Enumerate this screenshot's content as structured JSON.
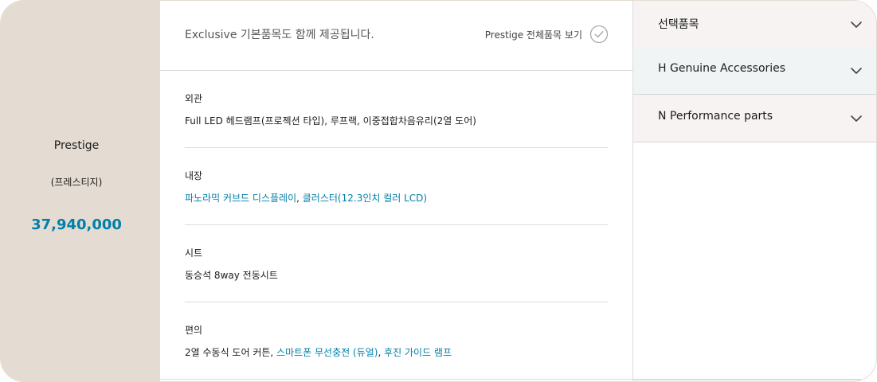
{
  "trim": {
    "name": "Prestige",
    "subtitle": "(프레스티지)",
    "price": "37,940,000"
  },
  "header": {
    "description": "Exclusive 기본품목도 함께 제공됩니다.",
    "view_all_label": "Prestige 전체품목 보기",
    "view_all_icon": "check-circle-icon"
  },
  "sections": [
    {
      "title": "외관",
      "items": [
        {
          "text": "Full LED 헤드램프(프로젝션 타입)",
          "link": false
        },
        {
          "text": ", ",
          "link": false
        },
        {
          "text": "루프랙",
          "link": false
        },
        {
          "text": ", ",
          "link": false
        },
        {
          "text": "이중접합차음유리(2열 도어)",
          "link": false
        }
      ]
    },
    {
      "title": "내장",
      "items": [
        {
          "text": "파노라믹 커브드 디스플레이",
          "link": true
        },
        {
          "text": ", ",
          "link": false
        },
        {
          "text": "클러스터(12.3인치 컬러 LCD)",
          "link": true
        }
      ]
    },
    {
      "title": "시트",
      "items": [
        {
          "text": "동승석 8way 전동시트",
          "link": false
        }
      ]
    },
    {
      "title": "편의",
      "items": [
        {
          "text": "2열 수동식 도어 커튼",
          "link": false
        },
        {
          "text": ", ",
          "link": false
        },
        {
          "text": "스마트폰 무선충전 (듀얼)",
          "link": true
        },
        {
          "text": ", ",
          "link": false
        },
        {
          "text": "후진 가이드 램프",
          "link": true
        }
      ]
    }
  ],
  "accordion": [
    {
      "label": "선택품목",
      "icon": "chevron-down-icon"
    },
    {
      "label": "H Genuine Accessories",
      "icon": "chevron-down-icon"
    },
    {
      "label": "N Performance parts",
      "icon": "chevron-down-icon"
    }
  ],
  "colors": {
    "accent": "#007fa8",
    "trim_bg": "#e4dcd3",
    "accordion_beige": "#f6f3f2",
    "accordion_blue": "#f0f4f5",
    "divider": "#dcdcdc"
  }
}
